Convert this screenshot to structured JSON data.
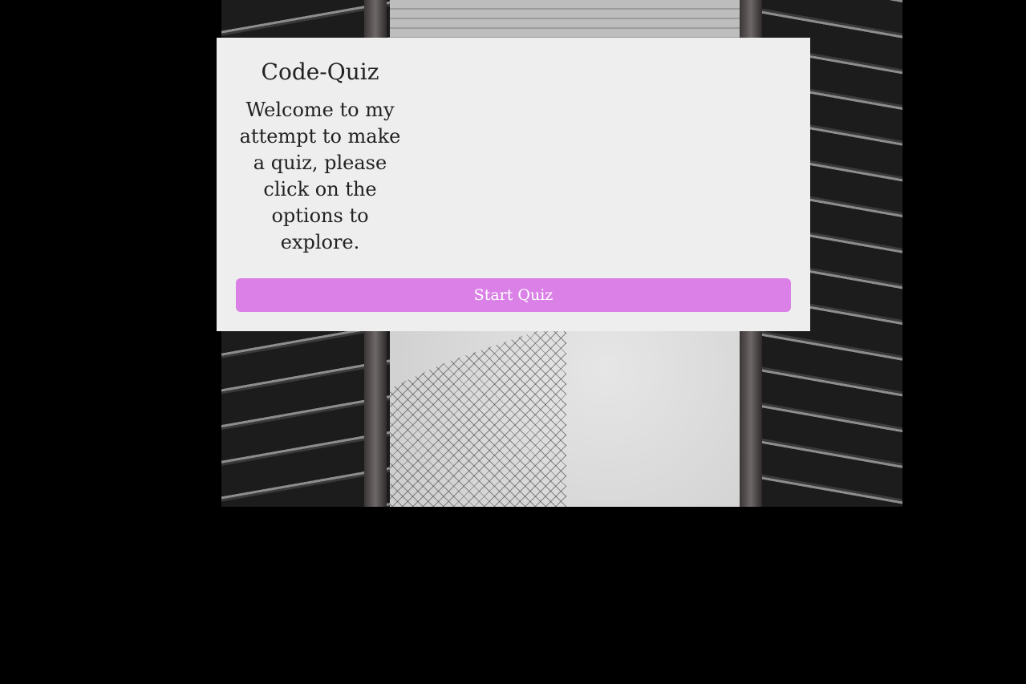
{
  "page": {
    "background_color": "#000000",
    "card_color": "#eeeeee",
    "accent_color": "#da80e6"
  },
  "quiz": {
    "title": "Code-Quiz",
    "welcome_text": "Welcome to my attempt to make a quiz, please click on the options to explore.",
    "start_button_label": "Start Quiz"
  }
}
